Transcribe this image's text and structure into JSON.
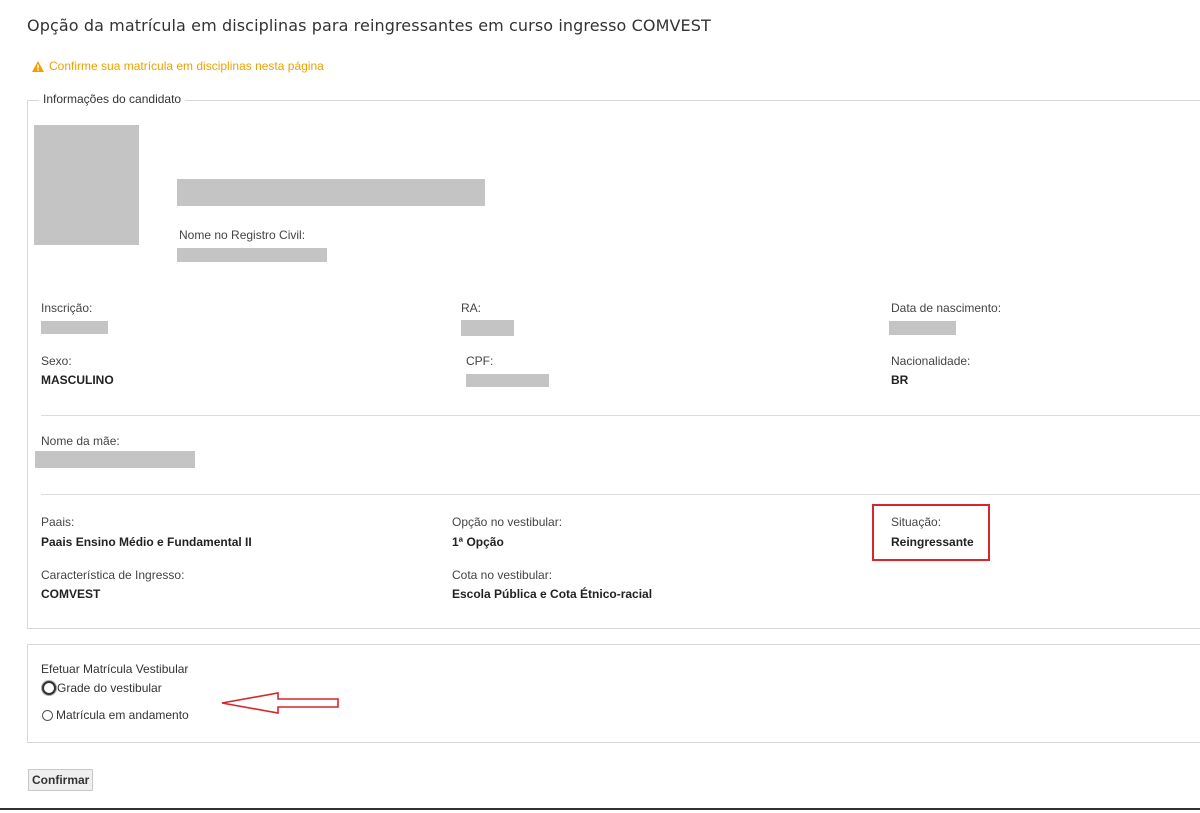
{
  "page": {
    "title": "Opção da matrícula em disciplinas para reingressantes em curso ingresso COMVEST",
    "warning": "Confirme sua matrícula em disciplinas nesta página"
  },
  "candidate": {
    "legend": "Informações do candidato",
    "registry_name_label": "Nome no Registro Civil:",
    "inscricao_label": "Inscrição:",
    "ra_label": "RA:",
    "birth_label": "Data de nascimento:",
    "sex_label": "Sexo:",
    "sex_value": "MASCULINO",
    "cpf_label": "CPF:",
    "nationality_label": "Nacionalidade:",
    "nationality_value": "BR",
    "mother_label": "Nome da mãe:",
    "paais_label": "Paais:",
    "paais_value": "Paais Ensino Médio e Fundamental II",
    "option_label": "Opção no vestibular:",
    "option_value": "1ª Opção",
    "status_label": "Situação:",
    "status_value": "Reingressante",
    "entry_label": "Característica de Ingresso:",
    "entry_value": "COMVEST",
    "quota_label": "Cota no vestibular:",
    "quota_value": "Escola Pública e Cota Étnico-racial"
  },
  "enrollment": {
    "title": "Efetuar Matrícula Vestibular",
    "options": [
      {
        "label": "Grade do vestibular",
        "selected": false
      },
      {
        "label": "Matrícula em andamento",
        "selected": false
      }
    ]
  },
  "actions": {
    "confirm_label": "Confirmar"
  },
  "colors": {
    "warning": "#f0a000",
    "highlight": "#d9252b",
    "redacted": "#c4c4c4"
  }
}
